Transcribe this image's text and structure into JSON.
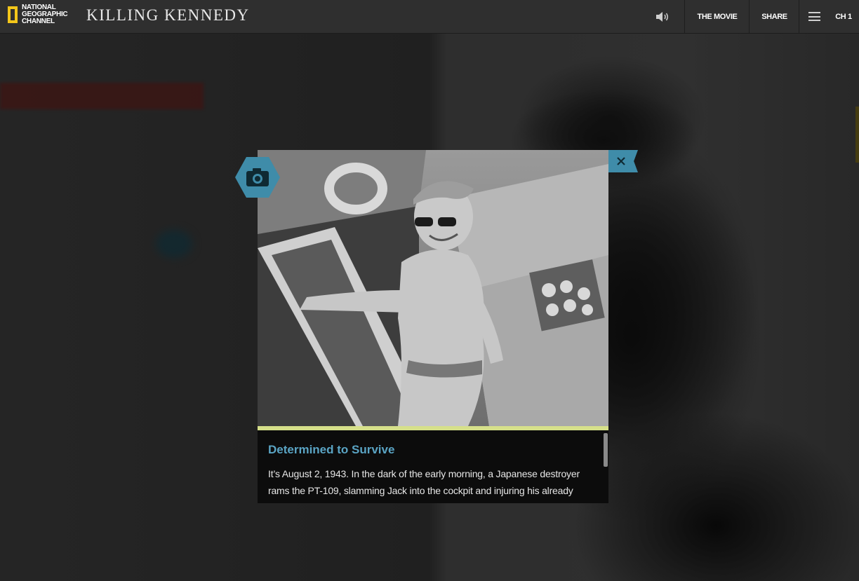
{
  "brand": {
    "logo_lines": [
      "NATIONAL",
      "GEOGRAPHIC",
      "CHANNEL"
    ],
    "show_title": "KILLING KENNEDY"
  },
  "nav": {
    "sound_icon": "speaker-icon",
    "movie_label": "THE MOVIE",
    "share_label": "SHARE",
    "menu_icon": "hamburger-icon",
    "chapter_label": "CH 1"
  },
  "modal": {
    "badge_icon": "camera-icon",
    "close_icon": "close-icon",
    "photo_icon": "photo-image",
    "accent_color": "#d6e08a",
    "heading": "Determined to Survive",
    "body": "It’s August 2, 1943. In the dark of the early morning, a Japanese destroyer rams the PT-109, slamming Jack into the cockpit and injuring his already weakened back. With two dead and the others wounded, Jack directs his"
  },
  "colors": {
    "heading_blue": "#5aa4c4",
    "badge_teal": "#3f8ca9",
    "logo_yellow": "#f3c61a"
  }
}
